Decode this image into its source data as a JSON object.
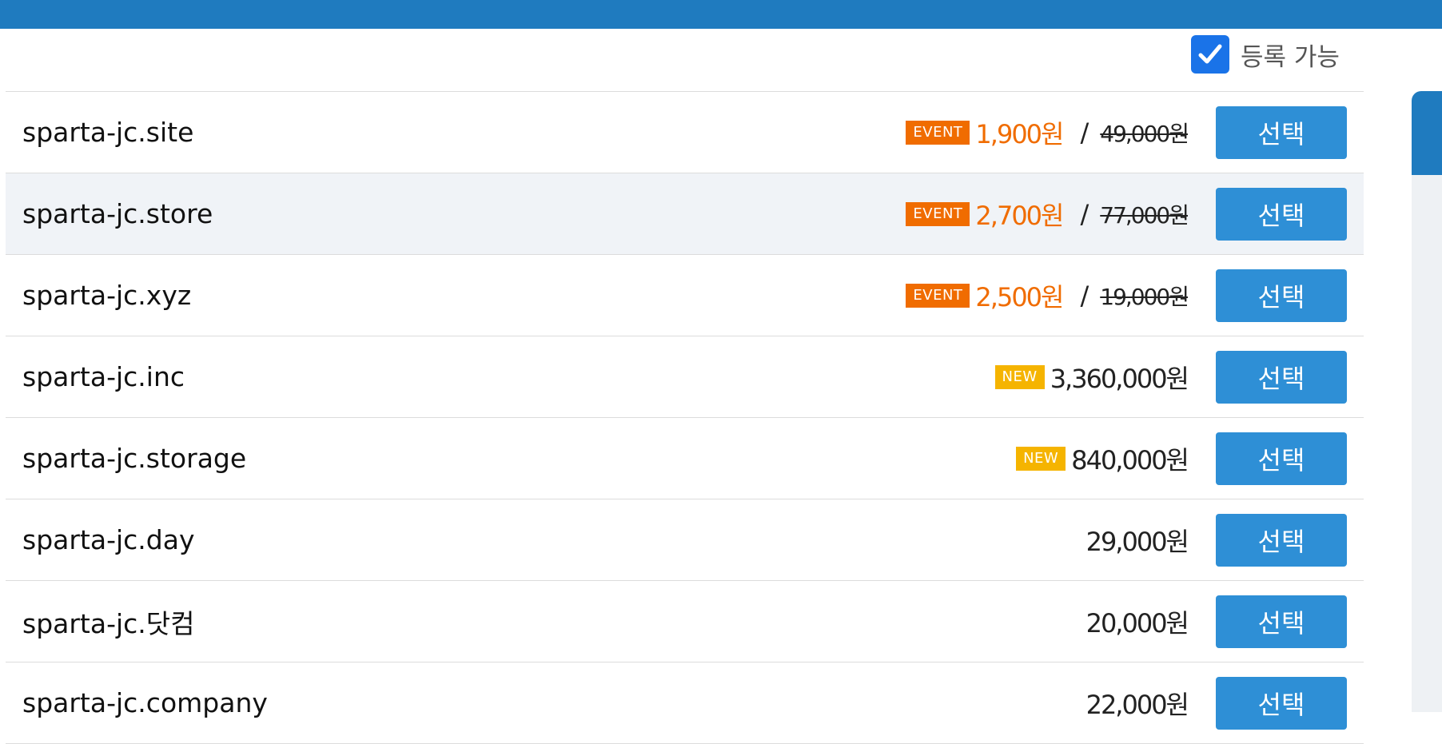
{
  "filter": {
    "available_label": "등록 가능",
    "available_checked": true
  },
  "select_label": "선택",
  "colors": {
    "topbar": "#1f7bbf",
    "button": "#2e8fd6",
    "event": "#f06c00",
    "new": "#f5b400"
  },
  "rows": [
    {
      "domain": "sparta-jc.site",
      "badge": "EVENT",
      "price": "1,900원",
      "separator": "/",
      "original_price": "49,000원"
    },
    {
      "domain": "sparta-jc.store",
      "badge": "EVENT",
      "price": "2,700원",
      "separator": "/",
      "original_price": "77,000원"
    },
    {
      "domain": "sparta-jc.xyz",
      "badge": "EVENT",
      "price": "2,500원",
      "separator": "/",
      "original_price": "19,000원"
    },
    {
      "domain": "sparta-jc.inc",
      "badge": "NEW",
      "price": "3,360,000원"
    },
    {
      "domain": "sparta-jc.storage",
      "badge": "NEW",
      "price": "840,000원"
    },
    {
      "domain": "sparta-jc.day",
      "price": "29,000원"
    },
    {
      "domain": "sparta-jc.닷컴",
      "price": "20,000원"
    },
    {
      "domain": "sparta-jc.company",
      "price": "22,000원"
    }
  ]
}
